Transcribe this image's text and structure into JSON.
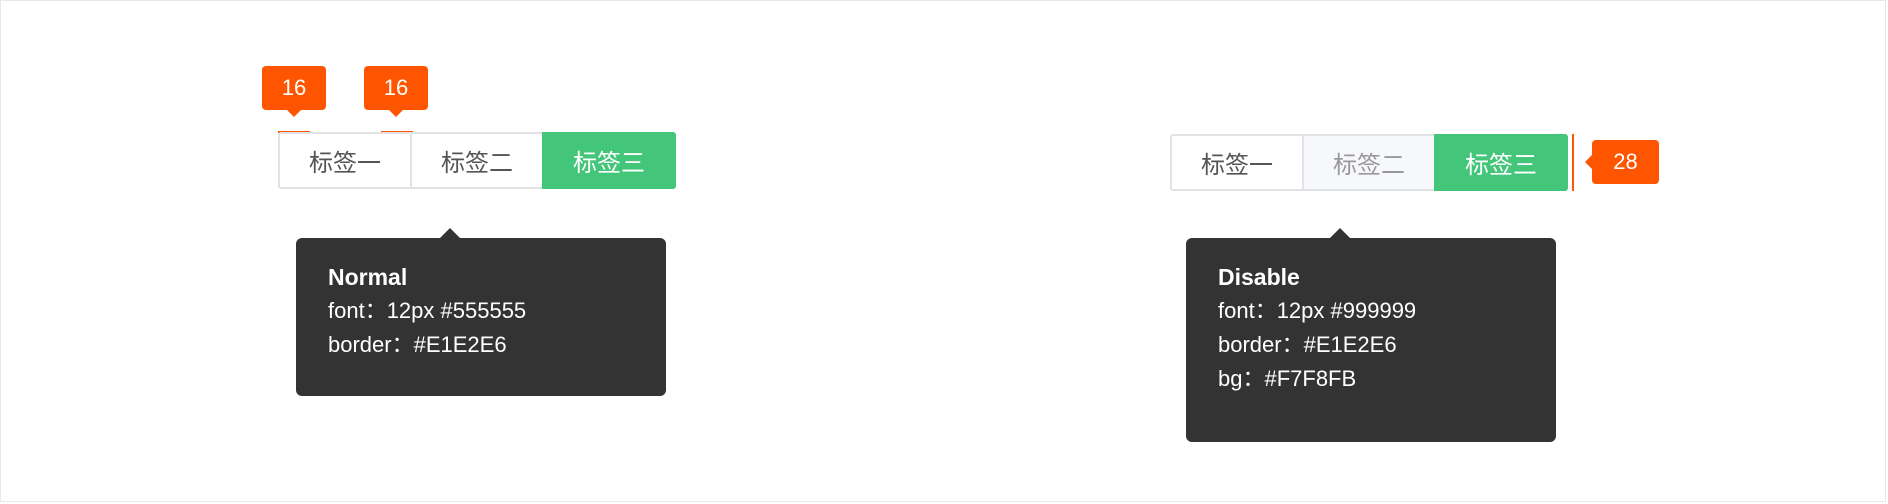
{
  "normal": {
    "tabs": [
      {
        "label": "标签一",
        "state": "normal"
      },
      {
        "label": "标签二",
        "state": "normal"
      },
      {
        "label": "标签三",
        "state": "active"
      }
    ],
    "badges": [
      "16",
      "16"
    ],
    "tooltip": {
      "title": "Normal",
      "lines": [
        "font：12px #555555",
        "border：#E1E2E6"
      ]
    }
  },
  "disable": {
    "tabs": [
      {
        "label": "标签一",
        "state": "normal"
      },
      {
        "label": "标签二",
        "state": "disabled"
      },
      {
        "label": "标签三",
        "state": "active"
      }
    ],
    "badge": "28",
    "tooltip": {
      "title": "Disable",
      "lines": [
        "font：12px #999999",
        "border：#E1E2E6",
        "bg：#F7F8FB"
      ]
    }
  },
  "colors": {
    "active_bg": "#43C679",
    "badge": "#FF5500",
    "tooltip_bg": "#333333",
    "border": "#E1E2E6",
    "disabled_bg": "#F7F8FB"
  }
}
